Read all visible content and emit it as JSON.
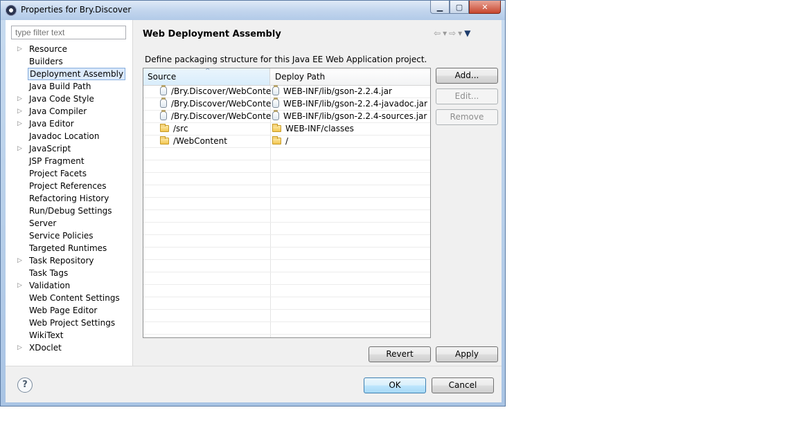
{
  "window": {
    "title": "Properties for Bry.Discover",
    "buttons": {
      "minimize": "▁",
      "maximize": "▢",
      "close": "✕"
    }
  },
  "sidebar": {
    "filter_placeholder": "type filter text",
    "items": [
      {
        "label": "Resource",
        "expandable": true
      },
      {
        "label": "Builders",
        "expandable": false
      },
      {
        "label": "Deployment Assembly",
        "expandable": false,
        "selected": true
      },
      {
        "label": "Java Build Path",
        "expandable": false
      },
      {
        "label": "Java Code Style",
        "expandable": true
      },
      {
        "label": "Java Compiler",
        "expandable": true
      },
      {
        "label": "Java Editor",
        "expandable": true
      },
      {
        "label": "Javadoc Location",
        "expandable": false
      },
      {
        "label": "JavaScript",
        "expandable": true
      },
      {
        "label": "JSP Fragment",
        "expandable": false
      },
      {
        "label": "Project Facets",
        "expandable": false
      },
      {
        "label": "Project References",
        "expandable": false
      },
      {
        "label": "Refactoring History",
        "expandable": false
      },
      {
        "label": "Run/Debug Settings",
        "expandable": false
      },
      {
        "label": "Server",
        "expandable": false
      },
      {
        "label": "Service Policies",
        "expandable": false
      },
      {
        "label": "Targeted Runtimes",
        "expandable": false
      },
      {
        "label": "Task Repository",
        "expandable": true
      },
      {
        "label": "Task Tags",
        "expandable": false
      },
      {
        "label": "Validation",
        "expandable": true
      },
      {
        "label": "Web Content Settings",
        "expandable": false
      },
      {
        "label": "Web Page Editor",
        "expandable": false
      },
      {
        "label": "Web Project Settings",
        "expandable": false
      },
      {
        "label": "WikiText",
        "expandable": false
      },
      {
        "label": "XDoclet",
        "expandable": true
      }
    ]
  },
  "page": {
    "title": "Web Deployment Assembly",
    "description": "Define packaging structure for this Java EE Web Application project.",
    "nav": {
      "back": "⇦",
      "forward": "⇨",
      "dropdown": "▾",
      "menu": "▼"
    }
  },
  "table": {
    "columns": {
      "source": "Source",
      "deploy": "Deploy Path"
    },
    "rows": [
      {
        "source": "/Bry.Discover/WebConten",
        "deploy": "WEB-INF/lib/gson-2.2.4.jar",
        "src_icon": "jar-icon",
        "dst_icon": "jar-icon"
      },
      {
        "source": "/Bry.Discover/WebConten",
        "deploy": "WEB-INF/lib/gson-2.2.4-javadoc.jar",
        "src_icon": "jar-icon",
        "dst_icon": "jar-icon"
      },
      {
        "source": "/Bry.Discover/WebConten",
        "deploy": "WEB-INF/lib/gson-2.2.4-sources.jar",
        "src_icon": "jar-icon",
        "dst_icon": "jar-icon"
      },
      {
        "source": "/src",
        "deploy": "WEB-INF/classes",
        "src_icon": "folder-icon",
        "dst_icon": "folder-icon"
      },
      {
        "source": "/WebContent",
        "deploy": "/",
        "src_icon": "folder-icon",
        "dst_icon": "folder-icon"
      }
    ]
  },
  "buttons": {
    "add": "Add...",
    "edit": "Edit...",
    "remove": "Remove",
    "revert": "Revert",
    "apply": "Apply",
    "ok": "OK",
    "cancel": "Cancel",
    "help": "?"
  }
}
